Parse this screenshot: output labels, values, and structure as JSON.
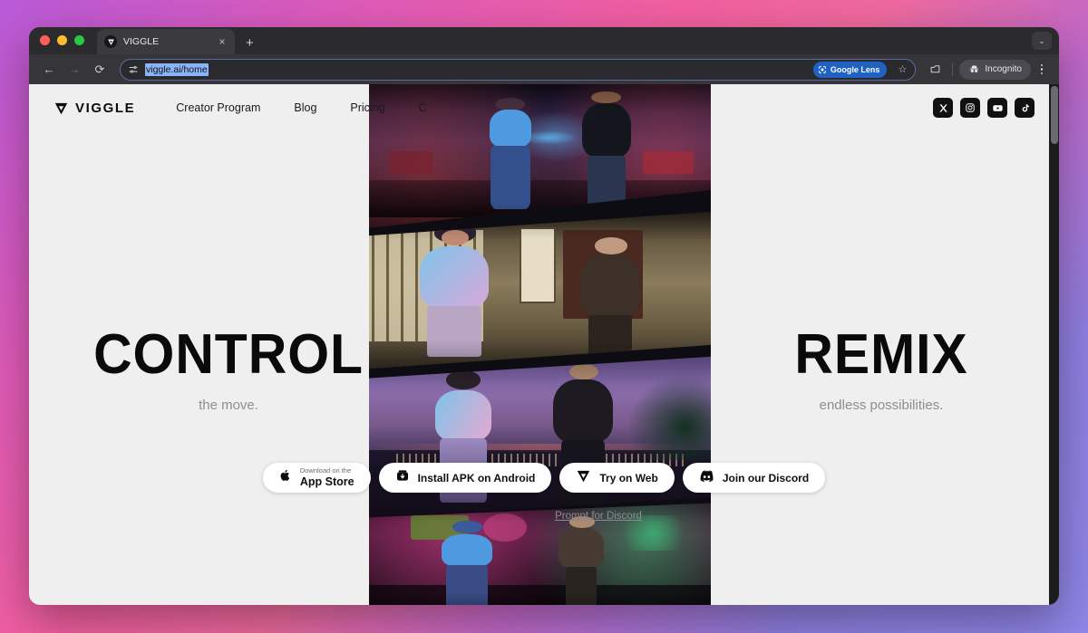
{
  "browser": {
    "tab": {
      "title": "VIGGLE",
      "favicon_icon": "viggle-logo-icon",
      "close_icon": "×"
    },
    "new_tab_icon": "+",
    "tabstrip_chevron_icon": "⌄",
    "back_icon": "←",
    "forward_icon": "→",
    "reload_icon": "⟳",
    "omnibox": {
      "tune_icon": "site-settings-icon",
      "url": "viggle.ai/home",
      "lens_label": "Google Lens",
      "lens_icon": "google-lens-icon",
      "star_icon": "☆"
    },
    "tab_group_icon": "tab-search-icon",
    "incognito_label": "Incognito",
    "incognito_icon": "incognito-hat-icon",
    "menu_icon": "kebab-menu-icon"
  },
  "site": {
    "brand": {
      "name": "VIGGLE",
      "logo_icon": "viggle-v-icon"
    },
    "nav_links": [
      {
        "label": "Creator Program"
      },
      {
        "label": "Blog"
      },
      {
        "label": "Pricing"
      },
      {
        "label": "C"
      }
    ],
    "socials": [
      {
        "name": "x-icon",
        "glyph": "𝕏"
      },
      {
        "name": "instagram-icon",
        "glyph": ""
      },
      {
        "name": "youtube-icon",
        "glyph": ""
      },
      {
        "name": "tiktok-icon",
        "glyph": "♪"
      }
    ],
    "hero_left": {
      "word": "CONTROL",
      "sub": "the move."
    },
    "hero_right": {
      "word": "REMIX",
      "sub": "endless possibilities."
    },
    "cta_buttons": [
      {
        "name": "app-store-button",
        "icon": "apple-icon",
        "line1": "Download on the",
        "line2": "App Store",
        "style": "two-line"
      },
      {
        "name": "install-apk-button",
        "icon": "android-apk-icon",
        "label": "Install APK on Android",
        "style": "single"
      },
      {
        "name": "try-on-web-button",
        "icon": "viggle-v-icon",
        "label": "Try on Web",
        "style": "single"
      },
      {
        "name": "join-discord-button",
        "icon": "discord-icon",
        "label": "Join our Discord",
        "style": "single"
      }
    ],
    "prompt_link": "Prompt for Discord",
    "video_panels": [
      {
        "name": "video-panel-nightclub",
        "scene": "nightclub bar with dancing couple"
      },
      {
        "name": "video-panel-japanese-room",
        "scene": "japanese interior with two characters"
      },
      {
        "name": "video-panel-rooftop-sunset",
        "scene": "rooftop at dusk with dancing couple"
      },
      {
        "name": "video-panel-party",
        "scene": "party venue with crowd and dancers"
      }
    ]
  },
  "colors": {
    "accent_blue": "#1f62c4",
    "page_bg": "#efefef",
    "text_dark": "#0a0a0a",
    "text_muted": "#8e8e92"
  }
}
